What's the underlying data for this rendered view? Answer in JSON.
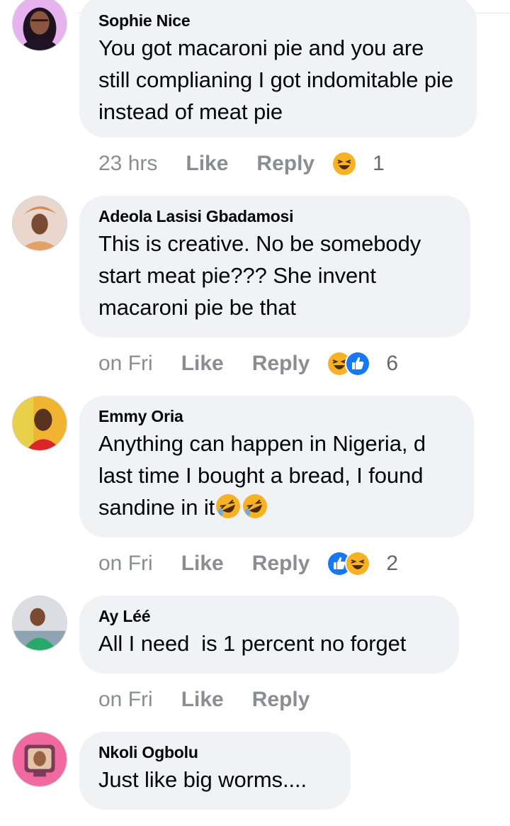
{
  "comments": [
    {
      "author": "Sophie Nice",
      "text": "You got macaroni pie and you are still complianing I got indomitable pie instead of meat pie",
      "time": "23 hrs",
      "like_label": "Like",
      "reply_label": "Reply",
      "reactions": [
        "haha-icon"
      ],
      "reaction_count": "1"
    },
    {
      "author": "Adeola Lasisi Gbadamosi",
      "text": "This is creative. No be somebody start meat pie??? She invent macaroni pie be that",
      "time": "on Fri",
      "like_label": "Like",
      "reply_label": "Reply",
      "reactions": [
        "haha-icon",
        "like-icon"
      ],
      "reaction_count": "6"
    },
    {
      "author": "Emmy Oria",
      "text": "Anything can happen in Nigeria, d last time I bought a bread, I found sandine in it",
      "text_emoji": [
        "rofl-emoji",
        "rofl-emoji"
      ],
      "time": "on Fri",
      "like_label": "Like",
      "reply_label": "Reply",
      "reactions": [
        "like-icon",
        "haha-icon"
      ],
      "reaction_count": "2"
    },
    {
      "author": "Ay Léé",
      "text": "All I need  is 1 percent no forget",
      "time": "on Fri",
      "like_label": "Like",
      "reply_label": "Reply",
      "reactions": [],
      "reaction_count": ""
    },
    {
      "author": "Nkoli Ogbolu",
      "text": "Just like big worms....",
      "time": "",
      "like_label": "",
      "reply_label": "",
      "reactions": [],
      "reaction_count": ""
    }
  ],
  "colors": {
    "bubble": "#f0f2f5",
    "meta_text": "#8a8d91",
    "like_blue": "#1877f2",
    "haha_yellow": "#f7b125"
  }
}
